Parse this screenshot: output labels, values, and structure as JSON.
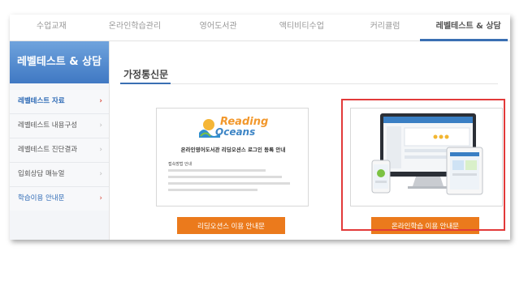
{
  "topnav": {
    "items": [
      {
        "label": "수업교재"
      },
      {
        "label": "온라인학습관리"
      },
      {
        "label": "영어도서관"
      },
      {
        "label": "액티비티수업"
      },
      {
        "label": "커리큘럼"
      },
      {
        "label": "레벨테스트 & 상담"
      }
    ],
    "active_index": 5
  },
  "sidebar": {
    "title": "레벨테스트 & 상담",
    "items": [
      {
        "label": "레벨테스트 자료"
      },
      {
        "label": "레벨테스트 내용구성"
      },
      {
        "label": "레벨테스트 진단결과"
      },
      {
        "label": "입회상담 매뉴얼"
      },
      {
        "label": "학습이용 안내문"
      }
    ]
  },
  "content": {
    "title": "가정통신문",
    "cards": [
      {
        "logo_line1": "Reading",
        "logo_line2": "Oceans",
        "doc_title": "온라인영어도서관 리딩오션스 로그인 등록 안내",
        "doc_label": "접속방법 안내",
        "button": "리딩오션스 이용 안내문"
      },
      {
        "button": "온라인학습 이용 안내문"
      }
    ]
  },
  "colors": {
    "accent_blue": "#3a6fb3",
    "button_orange": "#eb7a1c",
    "highlight_red": "#e23a3a"
  }
}
